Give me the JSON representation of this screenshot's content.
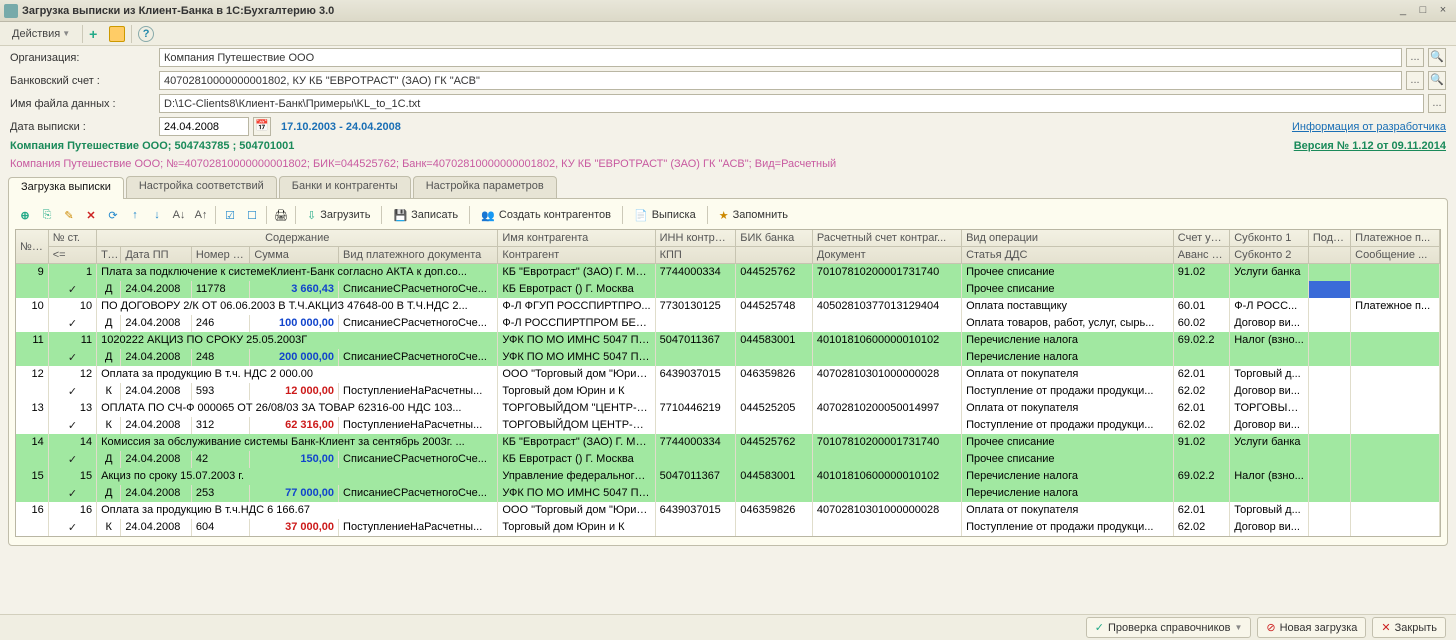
{
  "title": "Загрузка выписки из Клиент-Банка в 1С:Бухгалтерию 3.0",
  "menu": {
    "actions": "Действия"
  },
  "form": {
    "org_label": "Организация:",
    "org_value": "Компания Путешествие ООО",
    "acct_label": "Банковский счет :",
    "acct_value": "40702810000000001802, КУ КБ \"ЕВРОТРАСТ\" (ЗАО) ГК \"АСВ\"",
    "file_label": "Имя файла данных :",
    "file_value": "D:\\1C-Clients8\\Клиент-Банк\\Примеры\\KL_to_1C.txt",
    "date_label": "Дата выписки :",
    "date_value": "24.04.2008",
    "date_range": "17.10.2003 - 24.04.2008",
    "dev_link": "Информация от разработчика",
    "ver_link": "Версия № 1.12 от 09.11.2014"
  },
  "meta1": "Компания Путешествие ООО; 504743785 ; 504701001",
  "meta2": "Компания Путешествие ООО; №=40702810000000001802; БИК=044525762; Банк=40702810000000001802, КУ КБ \"ЕВРОТРАСТ\" (ЗАО) ГК \"АСВ\"; Вид=Расчетный",
  "tabs": [
    "Загрузка выписки",
    "Настройка соответствий",
    "Банки и контрагенты",
    "Настройка параметров"
  ],
  "tbar": {
    "load": "Загрузить",
    "save": "Записать",
    "create": "Создать контрагентов",
    "stmt": "Выписка",
    "rem": "Запомнить"
  },
  "cols": {
    "np": "№ п/п",
    "nst": "№ ст.",
    "sod": "Содержание",
    "imya": "Имя контрагента",
    "inn": "ИНН контраг...",
    "bik": "БИК банка",
    "rs": "Расчетный счет контраг...",
    "op": "Вид операции",
    "sch": "Счет уче...",
    "sub1": "Субконто 1",
    "pod": "Подр...",
    "plat": "Платежное п...",
    "le": "<=",
    "tip": "Тип",
    "dat": "Дата ПП",
    "npp": "Номер ПП",
    "sum": "Сумма",
    "vpd": "Вид платежного документа",
    "kon": "Контрагент",
    "kpp": "КПП",
    "doc": "Документ",
    "dds": "Статья ДДС",
    "av": "Аванс сч.",
    "sub2": "Субконто 2",
    "msg": "Сообщение ..."
  },
  "rows": [
    {
      "g": 1,
      "np": "9",
      "nst": "1",
      "sod": "Плата за подключение к системеКлиент-Банк согласно АКТА к доп.со...",
      "kon": "КБ \"Евротраст\" (ЗАО) Г. Мос...",
      "inn": "7744000334",
      "bik": "044525762",
      "rs": "70107810200001731740",
      "op": "Прочее списание",
      "sch": "91.02",
      "sub": "Услуги банка"
    },
    {
      "g": 1,
      "chk": 1,
      "tip": "Д",
      "dat": "24.04.2008",
      "npp": "11778",
      "sum": "3 660,43",
      "sumc": "blue",
      "vpd": "СписаниеСРасчетногоСче...",
      "kon": "КБ Евротраст () Г. Москва",
      "op": "Прочее списание",
      "sel": 1
    },
    {
      "g": 0,
      "np": "10",
      "nst": "10",
      "sod": "ПО ДОГОВОРУ 2/К ОТ 06.06.2003 В Т.Ч.АКЦИЗ 47648-00 В Т.Ч.НДС 2...",
      "kon": "Ф-Л ФГУП РОССПИРТПРО...",
      "inn": "7730130125",
      "bik": "044525748",
      "rs": "40502810377013129404",
      "op": "Оплата поставщику",
      "sch": "60.01",
      "sub": "Ф-Л РОСС...",
      "plat": "Платежное п..."
    },
    {
      "g": 0,
      "chk": 1,
      "tip": "Д",
      "dat": "24.04.2008",
      "npp": "246",
      "sum": "100 000,00",
      "sumc": "blue",
      "vpd": "СписаниеСРасчетногоСче...",
      "kon": "Ф-Л РОССПИРТПРОМ БЕРЕ...",
      "op": "Оплата товаров, работ, услуг, сырь...",
      "sch": "60.02",
      "sub": "Договор ви..."
    },
    {
      "g": 1,
      "np": "11",
      "nst": "11",
      "sod": "1020222 АКЦИЗ ПО СРОКУ 25.05.2003Г",
      "kon": "УФК ПО МО ИМНС 5047 ПО...",
      "inn": "5047011367",
      "bik": "044583001",
      "rs": "40101810600000010102",
      "op": "Перечисление налога",
      "sch": "69.02.2",
      "sub": "Налог (взно..."
    },
    {
      "g": 1,
      "chk": 1,
      "tip": "Д",
      "dat": "24.04.2008",
      "npp": "248",
      "sum": "200 000,00",
      "sumc": "blue",
      "vpd": "СписаниеСРасчетногоСче...",
      "kon": "УФК ПО МО ИМНС 5047 ПО...",
      "op": "Перечисление налога"
    },
    {
      "g": 0,
      "np": "12",
      "nst": "12",
      "sod": "Оплата за продукцию    В т.ч. НДС 2 000.00",
      "kon": "ООО \"Торговый дом \"Юрин ...",
      "inn": "6439037015",
      "bik": "046359826",
      "rs": "40702810301000000028",
      "op": "Оплата от покупателя",
      "sch": "62.01",
      "sub": "Торговый д..."
    },
    {
      "g": 0,
      "chk": 1,
      "tip": "К",
      "dat": "24.04.2008",
      "npp": "593",
      "sum": "12 000,00",
      "sumc": "red",
      "vpd": "ПоступлениеНаРасчетны...",
      "kon": "Торговый дом Юрин и К",
      "op": "Поступление от продажи продукци...",
      "sch": "62.02",
      "sub": "Договор ви..."
    },
    {
      "g": 0,
      "np": "13",
      "nst": "13",
      "sod": "ОПЛАТА ПО СЧ-Ф 000065 ОТ 26/08/03 ЗА ТОВАР  62316-00 НДС 103...",
      "kon": "ТОРГОВЫЙДОМ \"ЦЕНТР-А...",
      "inn": "7710446219",
      "bik": "044525205",
      "rs": "40702810200050014997",
      "op": "Оплата от покупателя",
      "sch": "62.01",
      "sub": "ТОРГОВЫЙ..."
    },
    {
      "g": 0,
      "chk": 1,
      "tip": "К",
      "dat": "24.04.2008",
      "npp": "312",
      "sum": "62 316,00",
      "sumc": "red",
      "vpd": "ПоступлениеНаРасчетны...",
      "kon": "ТОРГОВЫЙДОМ ЦЕНТР-АЛ...",
      "op": "Поступление от продажи продукци...",
      "sch": "62.02",
      "sub": "Договор ви..."
    },
    {
      "g": 1,
      "np": "14",
      "nst": "14",
      "sod": "Комиссия за обслуживание системы Банк-Клиент за сентябрь 2003г. ...",
      "kon": "КБ \"Евротраст\" (ЗАО) Г. Мос...",
      "inn": "7744000334",
      "bik": "044525762",
      "rs": "70107810200001731740",
      "op": "Прочее списание",
      "sch": "91.02",
      "sub": "Услуги банка"
    },
    {
      "g": 1,
      "chk": 1,
      "tip": "Д",
      "dat": "24.04.2008",
      "npp": "42",
      "sum": "150,00",
      "sumc": "blue",
      "vpd": "СписаниеСРасчетногоСче...",
      "kon": "КБ Евротраст () Г. Москва",
      "op": "Прочее списание"
    },
    {
      "g": 1,
      "np": "15",
      "nst": "15",
      "sod": "Акциз по сроку 15.07.2003 г.",
      "kon": "Управление федерального ...",
      "inn": "5047011367",
      "bik": "044583001",
      "rs": "40101810600000010102",
      "op": "Перечисление налога",
      "sch": "69.02.2",
      "sub": "Налог (взно..."
    },
    {
      "g": 1,
      "chk": 1,
      "tip": "Д",
      "dat": "24.04.2008",
      "npp": "253",
      "sum": "77 000,00",
      "sumc": "blue",
      "vpd": "СписаниеСРасчетногоСче...",
      "kon": "УФК ПО МО ИМНС 5047 ПО...",
      "op": "Перечисление налога"
    },
    {
      "g": 0,
      "np": "16",
      "nst": "16",
      "sod": "Оплата за продукцию    В т.ч.НДС 6 166.67",
      "kon": "ООО \"Торговый дом \"Юрин ...",
      "inn": "6439037015",
      "bik": "046359826",
      "rs": "40702810301000000028",
      "op": "Оплата от покупателя",
      "sch": "62.01",
      "sub": "Торговый д..."
    },
    {
      "g": 0,
      "chk": 1,
      "tip": "К",
      "dat": "24.04.2008",
      "npp": "604",
      "sum": "37 000,00",
      "sumc": "red",
      "vpd": "ПоступлениеНаРасчетны...",
      "kon": "Торговый дом Юрин и К",
      "op": "Поступление от продажи продукци...",
      "sch": "62.02",
      "sub": "Договор ви..."
    }
  ],
  "footer": {
    "chk": "Проверка справочников",
    "new": "Новая загрузка",
    "close": "Закрыть"
  }
}
